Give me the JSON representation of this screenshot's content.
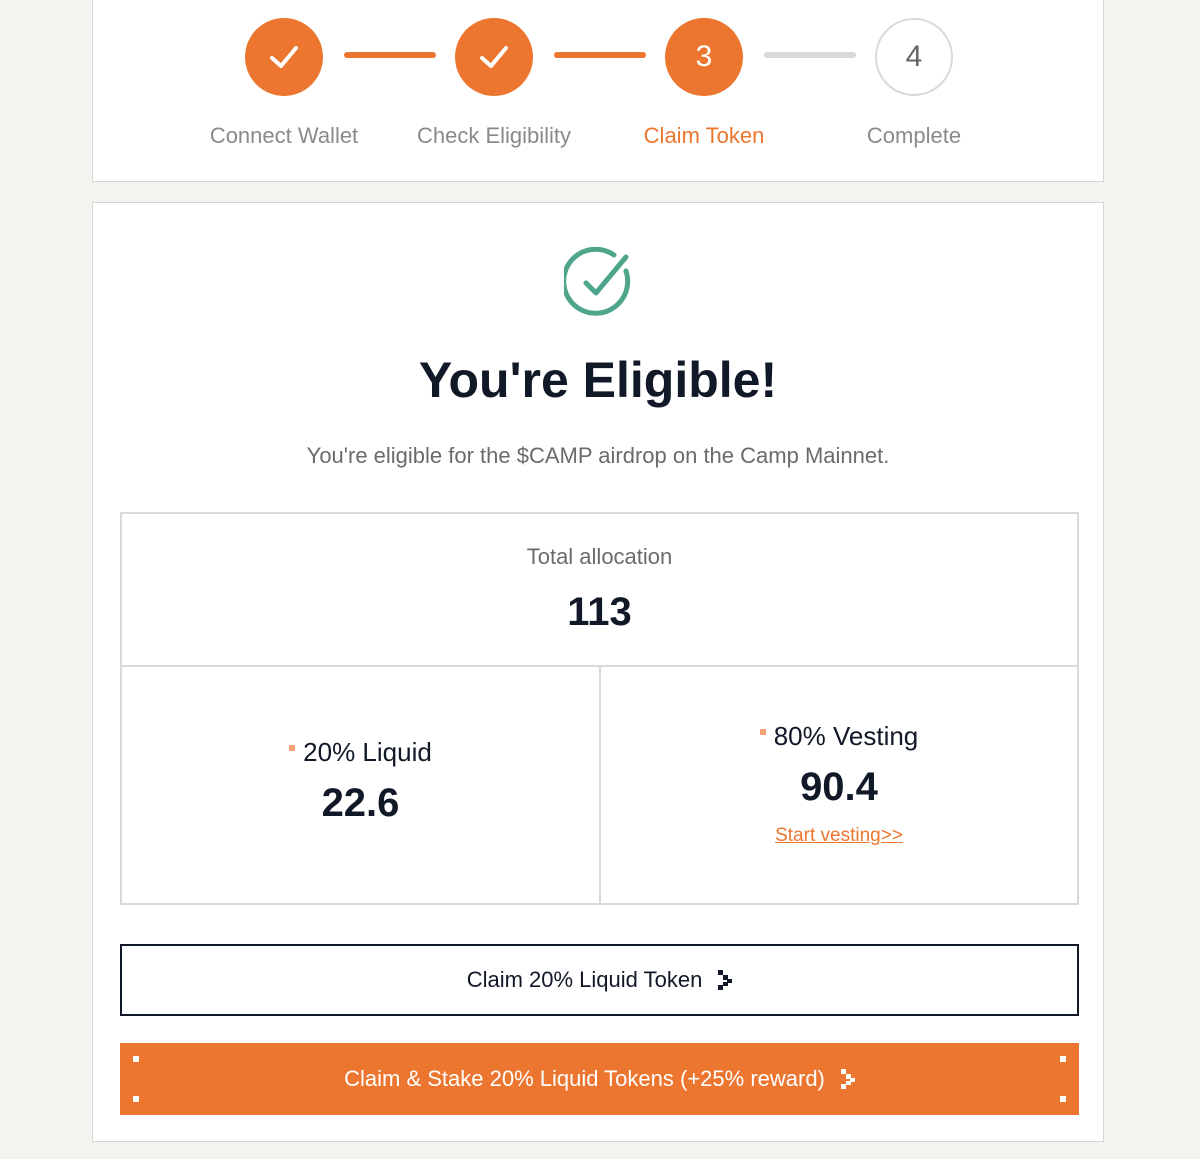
{
  "stepper": {
    "steps": [
      {
        "label": "Connect Wallet",
        "number": "1",
        "status": "done",
        "icon": "check-icon"
      },
      {
        "label": "Check Eligibility",
        "number": "2",
        "status": "done",
        "icon": "check-icon"
      },
      {
        "label": "Claim Token",
        "number": "3",
        "status": "active"
      },
      {
        "label": "Complete",
        "number": "4",
        "status": "pending"
      }
    ]
  },
  "result": {
    "icon": "circle-check-icon",
    "title": "You're Eligible!",
    "subtitle": "You're eligible for the $CAMP airdrop on the Camp Mainnet."
  },
  "allocation": {
    "total_label": "Total allocation",
    "total_value": "113",
    "liquid": {
      "label": "20% Liquid",
      "value": "22.6"
    },
    "vesting": {
      "label": "80% Vesting",
      "value": "90.4",
      "link": "Start vesting>>"
    }
  },
  "actions": {
    "claim_label": "Claim 20% Liquid Token",
    "claim_stake_label": "Claim & Stake 20% Liquid Tokens (+25% reward)",
    "arrow_icon": "pixel-arrow-icon"
  },
  "colors": {
    "accent": "#ec762f",
    "success": "#4fa58b",
    "text_dark": "#111827",
    "border": "#d9d9d9",
    "background": "#f5f3ef"
  }
}
